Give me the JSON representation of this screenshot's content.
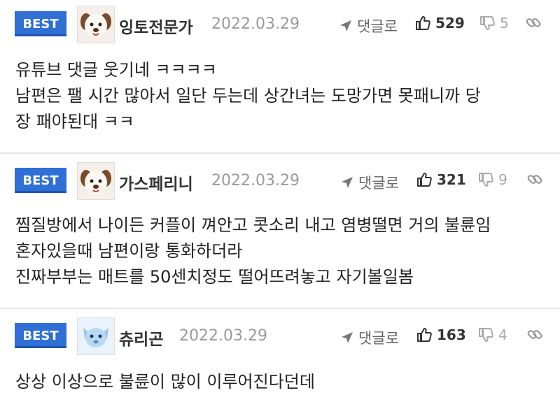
{
  "comments": [
    {
      "badge": "BEST",
      "nickname": "잉토전문가",
      "date": "2022.03.29",
      "reply_label": "댓글로",
      "likes": "529",
      "dislikes": "5",
      "avatar": "dog-face",
      "lines": [
        "유튜브 댓글 웃기네 ㅋㅋㅋㅋ",
        "남편은 팰 시간 많아서 일단 두는데 상간녀는 도망가면 못패니까 당",
        "장 패야된대 ㅋㅋ"
      ]
    },
    {
      "badge": "BEST",
      "nickname": "가스페리니",
      "date": "2022.03.29",
      "reply_label": "댓글로",
      "likes": "321",
      "dislikes": "9",
      "avatar": "dog-face",
      "lines": [
        "찜질방에서 나이든 커플이 껴안고 콧소리 내고 염병떨면 거의 불륜임",
        "혼자있을때 남편이랑 통화하더라",
        "진짜부부는 매트를 50센치정도 떨어뜨려놓고 자기볼일봄"
      ]
    },
    {
      "badge": "BEST",
      "nickname": "츄리곤",
      "date": "2022.03.29",
      "reply_label": "댓글로",
      "likes": "163",
      "dislikes": "4",
      "avatar": "ice-creature",
      "lines": [
        "상상 이상으로 불륜이 많이 이루어진다던데"
      ]
    }
  ],
  "colors": {
    "badge": "#2f6fd6",
    "date": "#9a9a9a",
    "divider": "#e4e4e4"
  },
  "icons": [
    "reply-arrow-icon",
    "thumbs-up-icon",
    "thumbs-down-icon",
    "link-icon"
  ]
}
